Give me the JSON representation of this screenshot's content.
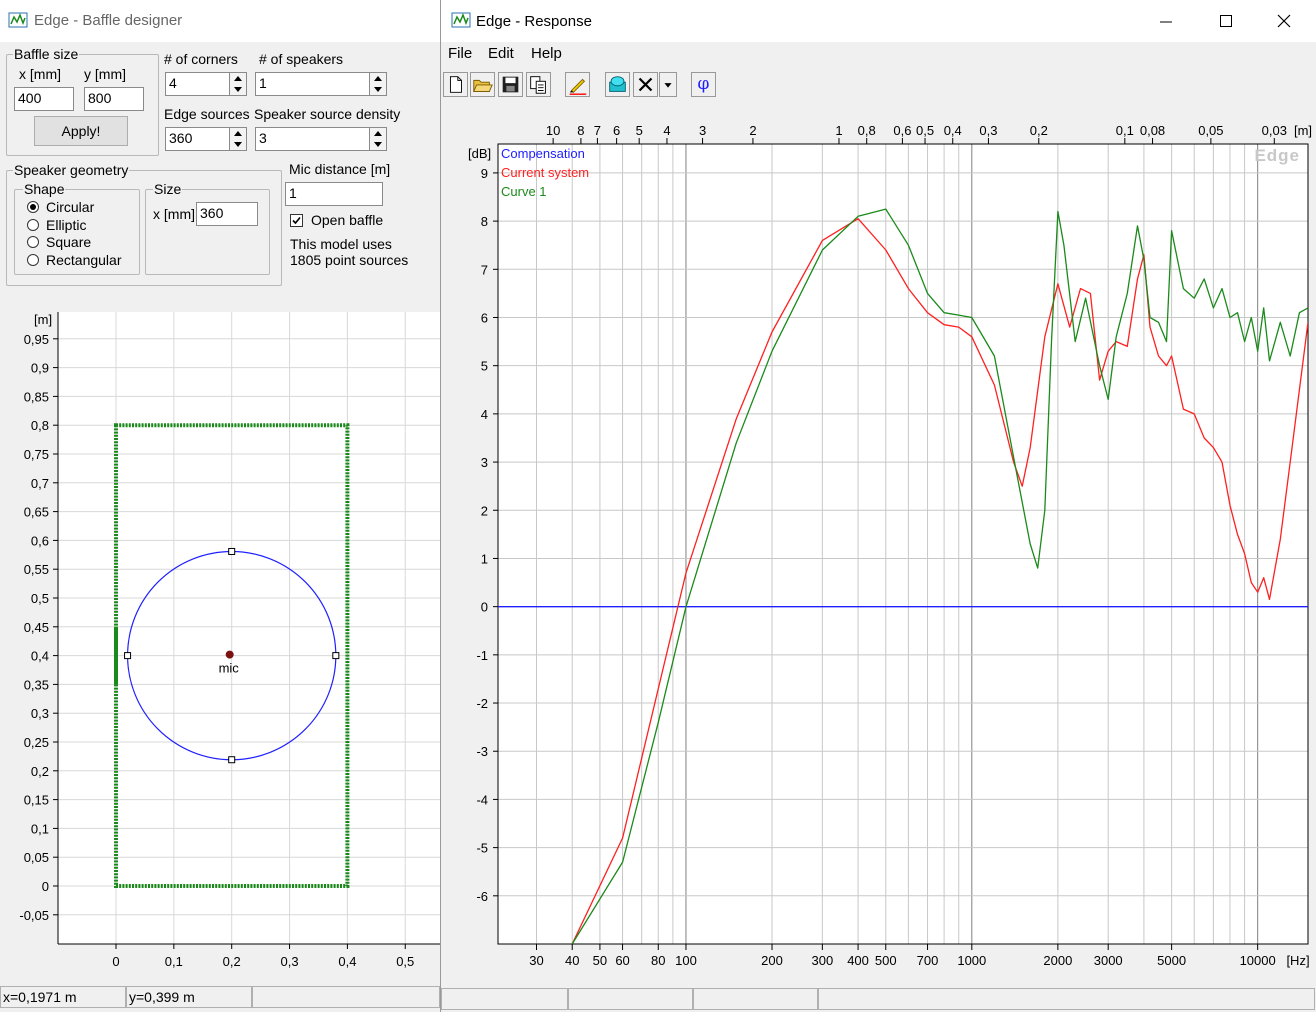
{
  "baffle_window": {
    "title": "Edge - Baffle designer",
    "baffle_size_label": "Baffle size",
    "x_label": "x [mm]",
    "y_label": "y [mm]",
    "x_value": "400",
    "y_value": "800",
    "apply_label": "Apply!",
    "corners_label": "# of corners",
    "corners_value": "4",
    "speakers_label": "# of speakers",
    "speakers_value": "1",
    "edge_sources_label": "Edge sources",
    "edge_sources_value": "360",
    "density_label": "Speaker source density",
    "density_value": "3",
    "geometry_label": "Speaker geometry",
    "shape_label": "Shape",
    "shapes": [
      "Circular",
      "Elliptic",
      "Square",
      "Rectangular"
    ],
    "selected_shape": "Circular",
    "size_label": "Size",
    "size_x_label": "x [mm]",
    "size_x_value": "360",
    "mic_distance_label": "Mic distance [m]",
    "mic_distance_value": "1",
    "open_baffle_label": "Open baffle",
    "open_baffle_checked": true,
    "model_info_line1": "This model uses",
    "model_info_line2": "1805 point sources",
    "plot": {
      "unit_label": "[m]",
      "y_ticks": [
        "0,95",
        "0,9",
        "0,85",
        "0,8",
        "0,75",
        "0,7",
        "0,65",
        "0,6",
        "0,55",
        "0,5",
        "0,45",
        "0,4",
        "0,35",
        "0,3",
        "0,25",
        "0,2",
        "0,15",
        "0,1",
        "0,05",
        "0",
        "-0,05"
      ],
      "x_ticks": [
        "0",
        "0,1",
        "0,2",
        "0,3",
        "0,4",
        "0,5"
      ],
      "mic_label": "mic",
      "baffle_color": "#1a8a1a",
      "speaker_color": "#2020ff"
    },
    "status_x": "x=0,1971 m",
    "status_y": "y=0,399 m"
  },
  "response_window": {
    "title": "Edge - Response",
    "menu": [
      "File",
      "Edit",
      "Help"
    ],
    "toolbar_icons": [
      "new-icon",
      "open-icon",
      "save-icon",
      "copy-icon",
      "pencil-icon",
      "speaker-icon",
      "delete-icon",
      "dropdown-icon",
      "phase-icon"
    ],
    "phase_symbol": "φ",
    "watermark": "Edge",
    "chart_data": {
      "type": "line",
      "ylabel": "[dB]",
      "xlabel": "[Hz]",
      "top_axis_label": "[m]",
      "xscale": "log",
      "xlim": [
        22,
        15000
      ],
      "ylim": [
        -7,
        9.6
      ],
      "y_ticks": [
        9,
        8,
        7,
        6,
        5,
        4,
        3,
        2,
        1,
        0,
        -1,
        -2,
        -3,
        -4,
        -5,
        -6
      ],
      "x_tick_labels": [
        "30",
        "40",
        "50",
        "60",
        "80",
        "100",
        "200",
        "300",
        "400",
        "500",
        "700",
        "1000",
        "2000",
        "3000",
        "5000",
        "10000"
      ],
      "x_tick_values": [
        30,
        40,
        50,
        60,
        80,
        100,
        200,
        300,
        400,
        500,
        700,
        1000,
        2000,
        3000,
        5000,
        10000
      ],
      "top_tick_labels": [
        "10",
        "8",
        "7",
        "6",
        "5",
        "4",
        "3",
        "2",
        "1",
        "0,8",
        "0,6",
        "0,5",
        "0,4",
        "0,3",
        "0,2",
        "0,1",
        "0,08",
        "0,05",
        "0,03"
      ],
      "top_tick_freqs": [
        34.3,
        42.9,
        49,
        57.2,
        68.6,
        85.8,
        114.3,
        171.5,
        343,
        428.8,
        571.7,
        686,
        857.5,
        1143.3,
        1715,
        3430,
        4287.5,
        6860,
        11433
      ],
      "grid": true,
      "legend_position": "top-left",
      "series": [
        {
          "name": "Compensation",
          "color": "#2020ff",
          "x": [
            22,
            15000
          ],
          "y": [
            0,
            0
          ]
        },
        {
          "name": "Current system",
          "color": "#ff2020",
          "x": [
            40,
            60,
            80,
            100,
            150,
            200,
            300,
            400,
            500,
            600,
            700,
            800,
            900,
            1000,
            1200,
            1400,
            1500,
            1600,
            1800,
            2000,
            2200,
            2400,
            2600,
            2800,
            3000,
            3200,
            3500,
            3800,
            4000,
            4200,
            4500,
            4800,
            5000,
            5500,
            6000,
            6500,
            7000,
            7500,
            8000,
            8500,
            9000,
            9500,
            10000,
            10500,
            11000,
            12000,
            13000,
            14000,
            15000
          ],
          "y": [
            -7,
            -4.8,
            -1.7,
            0.7,
            3.9,
            5.7,
            7.6,
            8.05,
            7.4,
            6.6,
            6.1,
            5.85,
            5.8,
            5.6,
            4.6,
            3.0,
            2.5,
            3.3,
            5.6,
            6.7,
            5.8,
            6.6,
            6.5,
            4.7,
            5.3,
            5.5,
            5.4,
            6.8,
            7.3,
            5.8,
            5.2,
            5.0,
            5.2,
            4.1,
            4.0,
            3.5,
            3.3,
            3.0,
            2.1,
            1.5,
            1.1,
            0.5,
            0.3,
            0.6,
            0.15,
            1.4,
            3.0,
            4.5,
            5.9
          ]
        },
        {
          "name": "Curve 1",
          "color": "#1a8a1a",
          "x": [
            40,
            60,
            80,
            100,
            150,
            200,
            300,
            400,
            500,
            600,
            700,
            800,
            900,
            1000,
            1200,
            1400,
            1600,
            1700,
            1800,
            1900,
            2000,
            2100,
            2300,
            2500,
            2800,
            3000,
            3200,
            3500,
            3800,
            4000,
            4200,
            4500,
            4800,
            5000,
            5500,
            6000,
            6500,
            7000,
            7500,
            8000,
            8500,
            9000,
            9500,
            10000,
            10500,
            11000,
            12000,
            13000,
            14000,
            15000
          ],
          "y": [
            -7,
            -5.3,
            -2.4,
            0,
            3.4,
            5.3,
            7.4,
            8.1,
            8.25,
            7.5,
            6.5,
            6.1,
            6.05,
            6.0,
            5.2,
            3.1,
            1.3,
            0.8,
            2.0,
            5.5,
            8.2,
            7.5,
            5.5,
            6.4,
            5.0,
            4.3,
            5.6,
            6.5,
            7.9,
            7.2,
            6.0,
            5.9,
            5.5,
            7.8,
            6.6,
            6.4,
            6.8,
            6.2,
            6.6,
            6.0,
            6.1,
            5.5,
            6.0,
            5.3,
            6.2,
            5.1,
            5.9,
            5.2,
            6.1,
            6.2
          ]
        }
      ]
    }
  }
}
